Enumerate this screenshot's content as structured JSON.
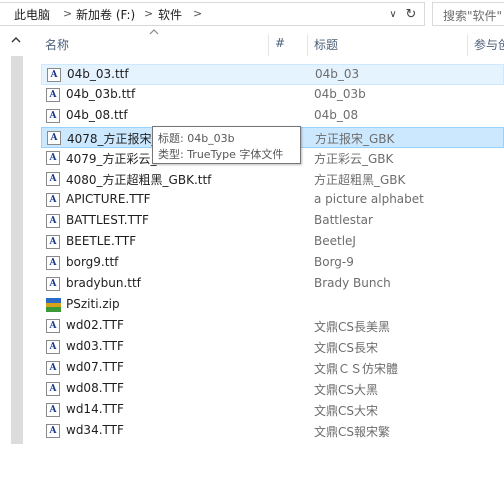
{
  "breadcrumb": {
    "items": [
      "此电脑",
      "新加卷 (F:)",
      "软件"
    ],
    "separator": ">"
  },
  "address": {
    "dropdown_glyph": "∨",
    "refresh_glyph": "↻"
  },
  "search": {
    "placeholder": "搜索\"软件\""
  },
  "columns": {
    "name": "名称",
    "number": "#",
    "title": "标题",
    "participants": "参与创"
  },
  "files": [
    {
      "name": "04b_03.ttf",
      "title": "04b_03",
      "icon": "font-file-icon"
    },
    {
      "name": "04b_03b.ttf",
      "title": "04b_03b",
      "icon": "font-file-icon"
    },
    {
      "name": "04b_08.ttf",
      "title": "04b_08",
      "icon": "font-file-icon"
    },
    {
      "name": "4078_方正报宋_",
      "title": "方正报宋_GBK",
      "icon": "font-file-icon"
    },
    {
      "name": "4079_方正彩云_",
      "title": "方正彩云_GBK",
      "icon": "font-file-icon"
    },
    {
      "name": "4080_方正超粗黑_GBK.ttf",
      "title": "方正超粗黑_GBK",
      "icon": "font-file-icon"
    },
    {
      "name": "APICTURE.TTF",
      "title": "a picture alphabet",
      "icon": "font-file-icon"
    },
    {
      "name": "BATTLEST.TTF",
      "title": "Battlestar",
      "icon": "font-file-icon"
    },
    {
      "name": "BEETLE.TTF",
      "title": "BeetleJ",
      "icon": "font-file-icon"
    },
    {
      "name": "borg9.ttf",
      "title": "Borg-9",
      "icon": "font-file-icon"
    },
    {
      "name": "bradybun.ttf",
      "title": "Brady Bunch",
      "icon": "font-file-icon"
    },
    {
      "name": "PSziti.zip",
      "title": "",
      "icon": "zip-archive-icon"
    },
    {
      "name": "wd02.TTF",
      "title": "文鼎CS長美黑",
      "icon": "font-file-icon"
    },
    {
      "name": "wd03.TTF",
      "title": "文鼎CS長宋",
      "icon": "font-file-icon"
    },
    {
      "name": "wd07.TTF",
      "title": "文鼎ＣＳ仿宋體",
      "icon": "font-file-icon"
    },
    {
      "name": "wd08.TTF",
      "title": "文鼎CS大黑",
      "icon": "font-file-icon"
    },
    {
      "name": "wd14.TTF",
      "title": "文鼎CS大宋",
      "icon": "font-file-icon"
    },
    {
      "name": "wd34.TTF",
      "title": "文鼎CS報宋繁",
      "icon": "font-file-icon"
    }
  ],
  "tooltip": {
    "title_line": "标题: 04b_03b",
    "type_line": "类型: TrueType 字体文件"
  },
  "font_icon_glyph": "A",
  "colors": {
    "selected_row": "#e5f3ff",
    "hover_row": "#cce8ff",
    "header_text": "#4c607a"
  }
}
